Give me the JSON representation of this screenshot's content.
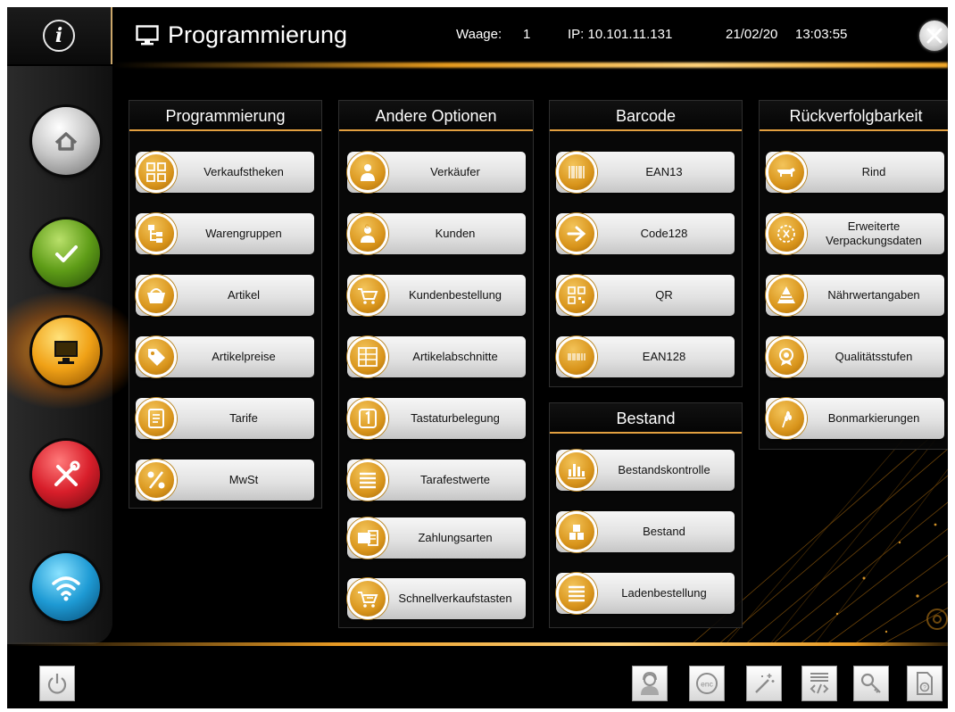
{
  "header": {
    "title": "Programmierung",
    "scale_label": "Waage:",
    "scale_value": "1",
    "ip": "IP: 10.101.11.131",
    "date": "21/02/20",
    "time": "13:03:55"
  },
  "sidebar": {
    "items": [
      "home-icon",
      "check-icon",
      "monitor-icon",
      "tools-icon",
      "wifi-icon"
    ],
    "active": "monitor-icon"
  },
  "panels": {
    "programmierung": {
      "title": "Programmierung",
      "buttons": [
        "Verkaufstheken",
        "Warengruppen",
        "Artikel",
        "Artikelpreise",
        "Tarife",
        "MwSt"
      ]
    },
    "andere": {
      "title": "Andere Optionen",
      "buttons": [
        "Verkäufer",
        "Kunden",
        "Kundenbestellung",
        "Artikelabschnitte",
        "Tastaturbelegung",
        "Tarafestwerte",
        "Zahlungsarten",
        "Schnellverkaufstasten"
      ]
    },
    "barcode": {
      "title": "Barcode",
      "buttons": [
        "EAN13",
        "Code128",
        "QR",
        "EAN128"
      ]
    },
    "bestand": {
      "title": "Bestand",
      "buttons": [
        "Bestandskontrolle",
        "Bestand",
        "Ladenbestellung"
      ]
    },
    "rueckverfolgbarkeit": {
      "title": "Rückverfolgbarkeit",
      "buttons": [
        "Rind",
        "Erweiterte Verpackungsdaten",
        "Nährwertangaben",
        "Qualitätsstufen",
        "Bonmarkierungen"
      ]
    }
  },
  "footer": {
    "icons": [
      "power-icon",
      "support-icon",
      "enc-icon",
      "magic-wand-icon",
      "code-icon",
      "key-icon",
      "help-document-icon"
    ]
  },
  "colors": {
    "accent": "#e59a1e",
    "button_icon": "#d9951c",
    "background": "#000000"
  }
}
